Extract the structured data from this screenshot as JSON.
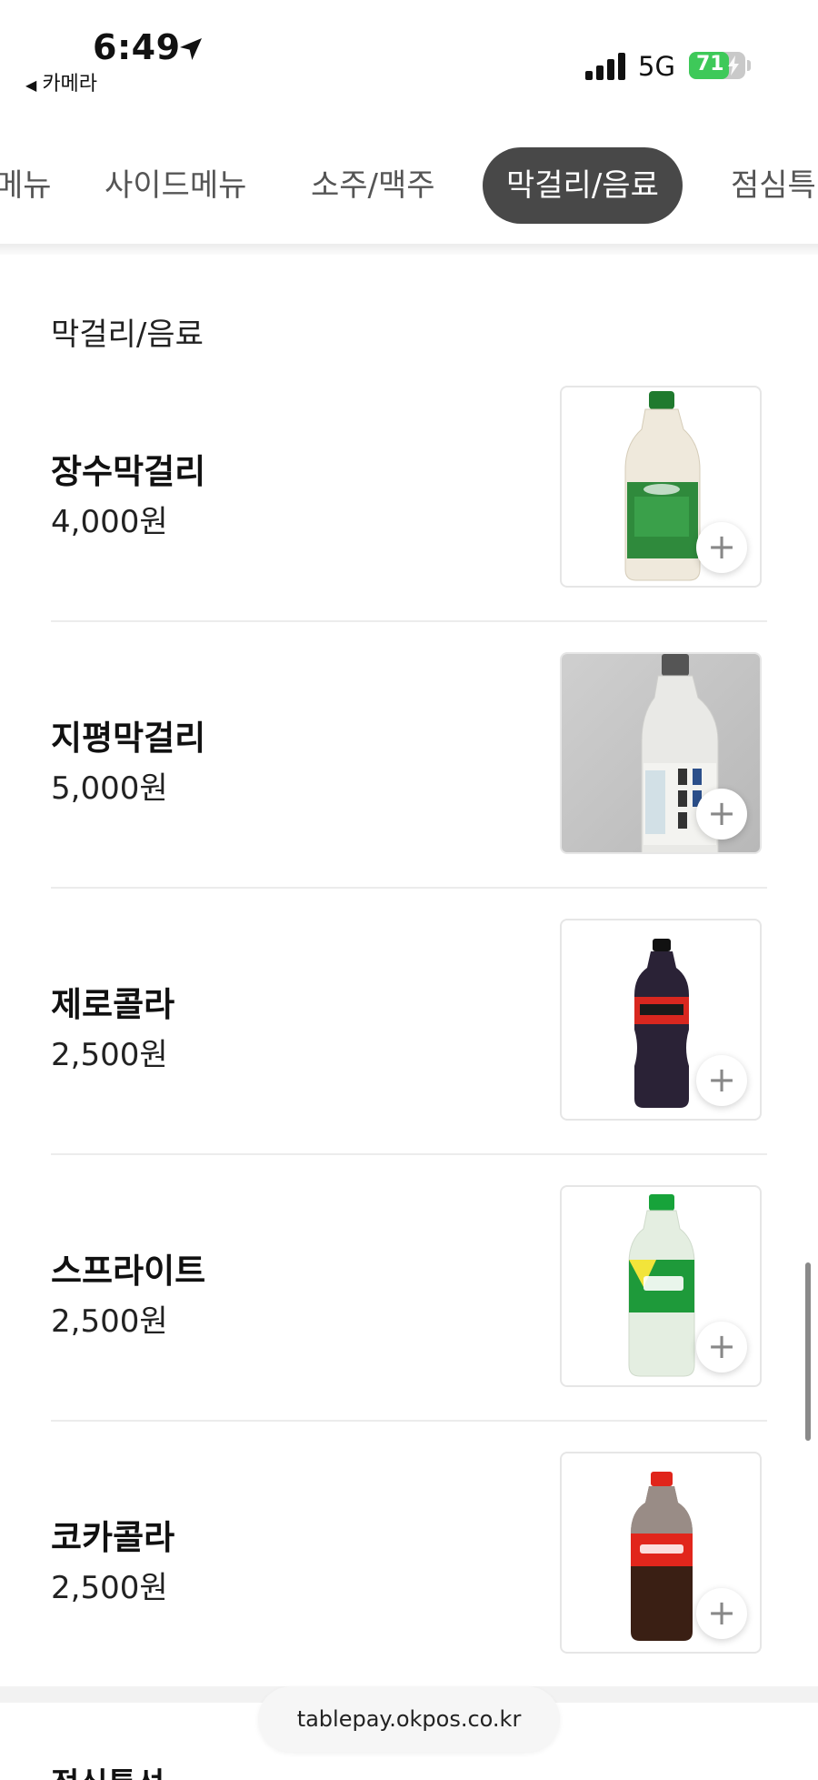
{
  "status_bar": {
    "time": "6:49",
    "back_app": "카메라",
    "network": "5G",
    "battery_level": "71",
    "battery_fraction": 0.71
  },
  "tabs": [
    {
      "label": "메뉴",
      "active": false
    },
    {
      "label": "사이드메뉴",
      "active": false
    },
    {
      "label": "소주/맥주",
      "active": false
    },
    {
      "label": "막걸리/음료",
      "active": true
    },
    {
      "label": "점심특",
      "active": false
    }
  ],
  "section": {
    "title": "막걸리/음료",
    "items": [
      {
        "name": "장수막걸리",
        "price": "4,000원",
        "image_icon": "makgeolli-green-bottle"
      },
      {
        "name": "지평막걸리",
        "price": "5,000원",
        "image_icon": "makgeolli-clear-bottle"
      },
      {
        "name": "제로콜라",
        "price": "2,500원",
        "image_icon": "zero-cola-bottle"
      },
      {
        "name": "스프라이트",
        "price": "2,500원",
        "image_icon": "sprite-bottle"
      },
      {
        "name": "코카콜라",
        "price": "2,500원",
        "image_icon": "coca-cola-bottle"
      }
    ],
    "add_symbol": "+"
  },
  "next_section_title": "점심특선",
  "url": "tablepay.okpos.co.kr",
  "colors": {
    "active_tab_bg": "#484848",
    "battery_green": "#3ec959"
  }
}
